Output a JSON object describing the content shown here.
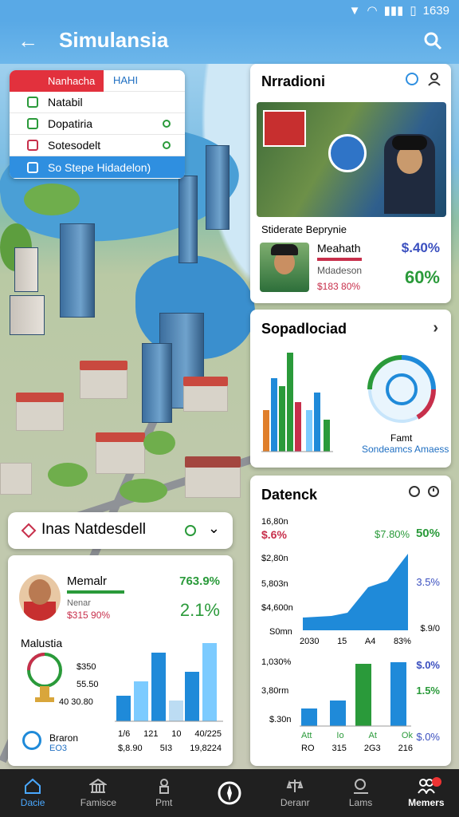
{
  "status": {
    "time": "1639"
  },
  "header": {
    "title": "Simulansia"
  },
  "legend": {
    "items": [
      {
        "label": "Nanhacha",
        "extra": "HAHI"
      },
      {
        "label": "Natabil"
      },
      {
        "label": "Dopatiria"
      },
      {
        "label": "Sotesodelt"
      },
      {
        "label": "So Stepe Hidadelon)"
      }
    ]
  },
  "news": {
    "title": "Nrradioni",
    "subtitle": "Stiderate Beprynie",
    "person_name": "Meahath",
    "person_role": "Mdadeson",
    "person_value": "$183 80%",
    "stat_a": "$.40%",
    "stat_b": "60%"
  },
  "stats": {
    "title": "Sopadlociad",
    "gauge_label": "Famt",
    "gauge_caption": "Sondeamcs Amaess",
    "colors": [
      "#e07f2b",
      "#2a9a3a",
      "#1f8ad9",
      "#c72f4b",
      "#7ccbff"
    ]
  },
  "datenck": {
    "title": "Datenck",
    "row1_left": "$.6%",
    "row1_mid": "$7.80%",
    "row1_right": "50%",
    "y_labels": [
      "16,80n",
      "$2,80n",
      "5,803n",
      "$4,600n",
      "S0mn"
    ],
    "area_x": [
      "2030",
      "15",
      "A4",
      "83%"
    ],
    "area_right": [
      "3.5%",
      "$.9/0"
    ],
    "bar_y_labels": [
      "1,030%",
      "3,80rm",
      "$.30n"
    ],
    "bar_right": [
      "$.0%",
      "1.5%",
      "$.0%"
    ],
    "bar_x": [
      "Att",
      "Io",
      "At",
      "Ok"
    ],
    "bar_x_vals": [
      "RO",
      "315",
      "2G3",
      "216"
    ]
  },
  "location": {
    "title": "Inas Natdesdell"
  },
  "profile": {
    "name": "Memalr",
    "sub": "Nenar",
    "value": "$315 90%",
    "pct_top": "763.9%",
    "pct_mid": "2.1%",
    "country": "Malustia",
    "left_vals": [
      "$350",
      "55.50",
      "40 30.80"
    ],
    "bottom_name": "Braron",
    "bottom_sub": "EO3",
    "x_labels": [
      "1/6",
      "121",
      "10",
      "40/225"
    ],
    "x_vals": [
      "$,8.90",
      "5I3",
      "19,8224"
    ]
  },
  "nav": {
    "items": [
      "Dacie",
      "Famisce",
      "Pmt",
      "",
      "Deranr",
      "Lams",
      "Memers"
    ]
  }
}
